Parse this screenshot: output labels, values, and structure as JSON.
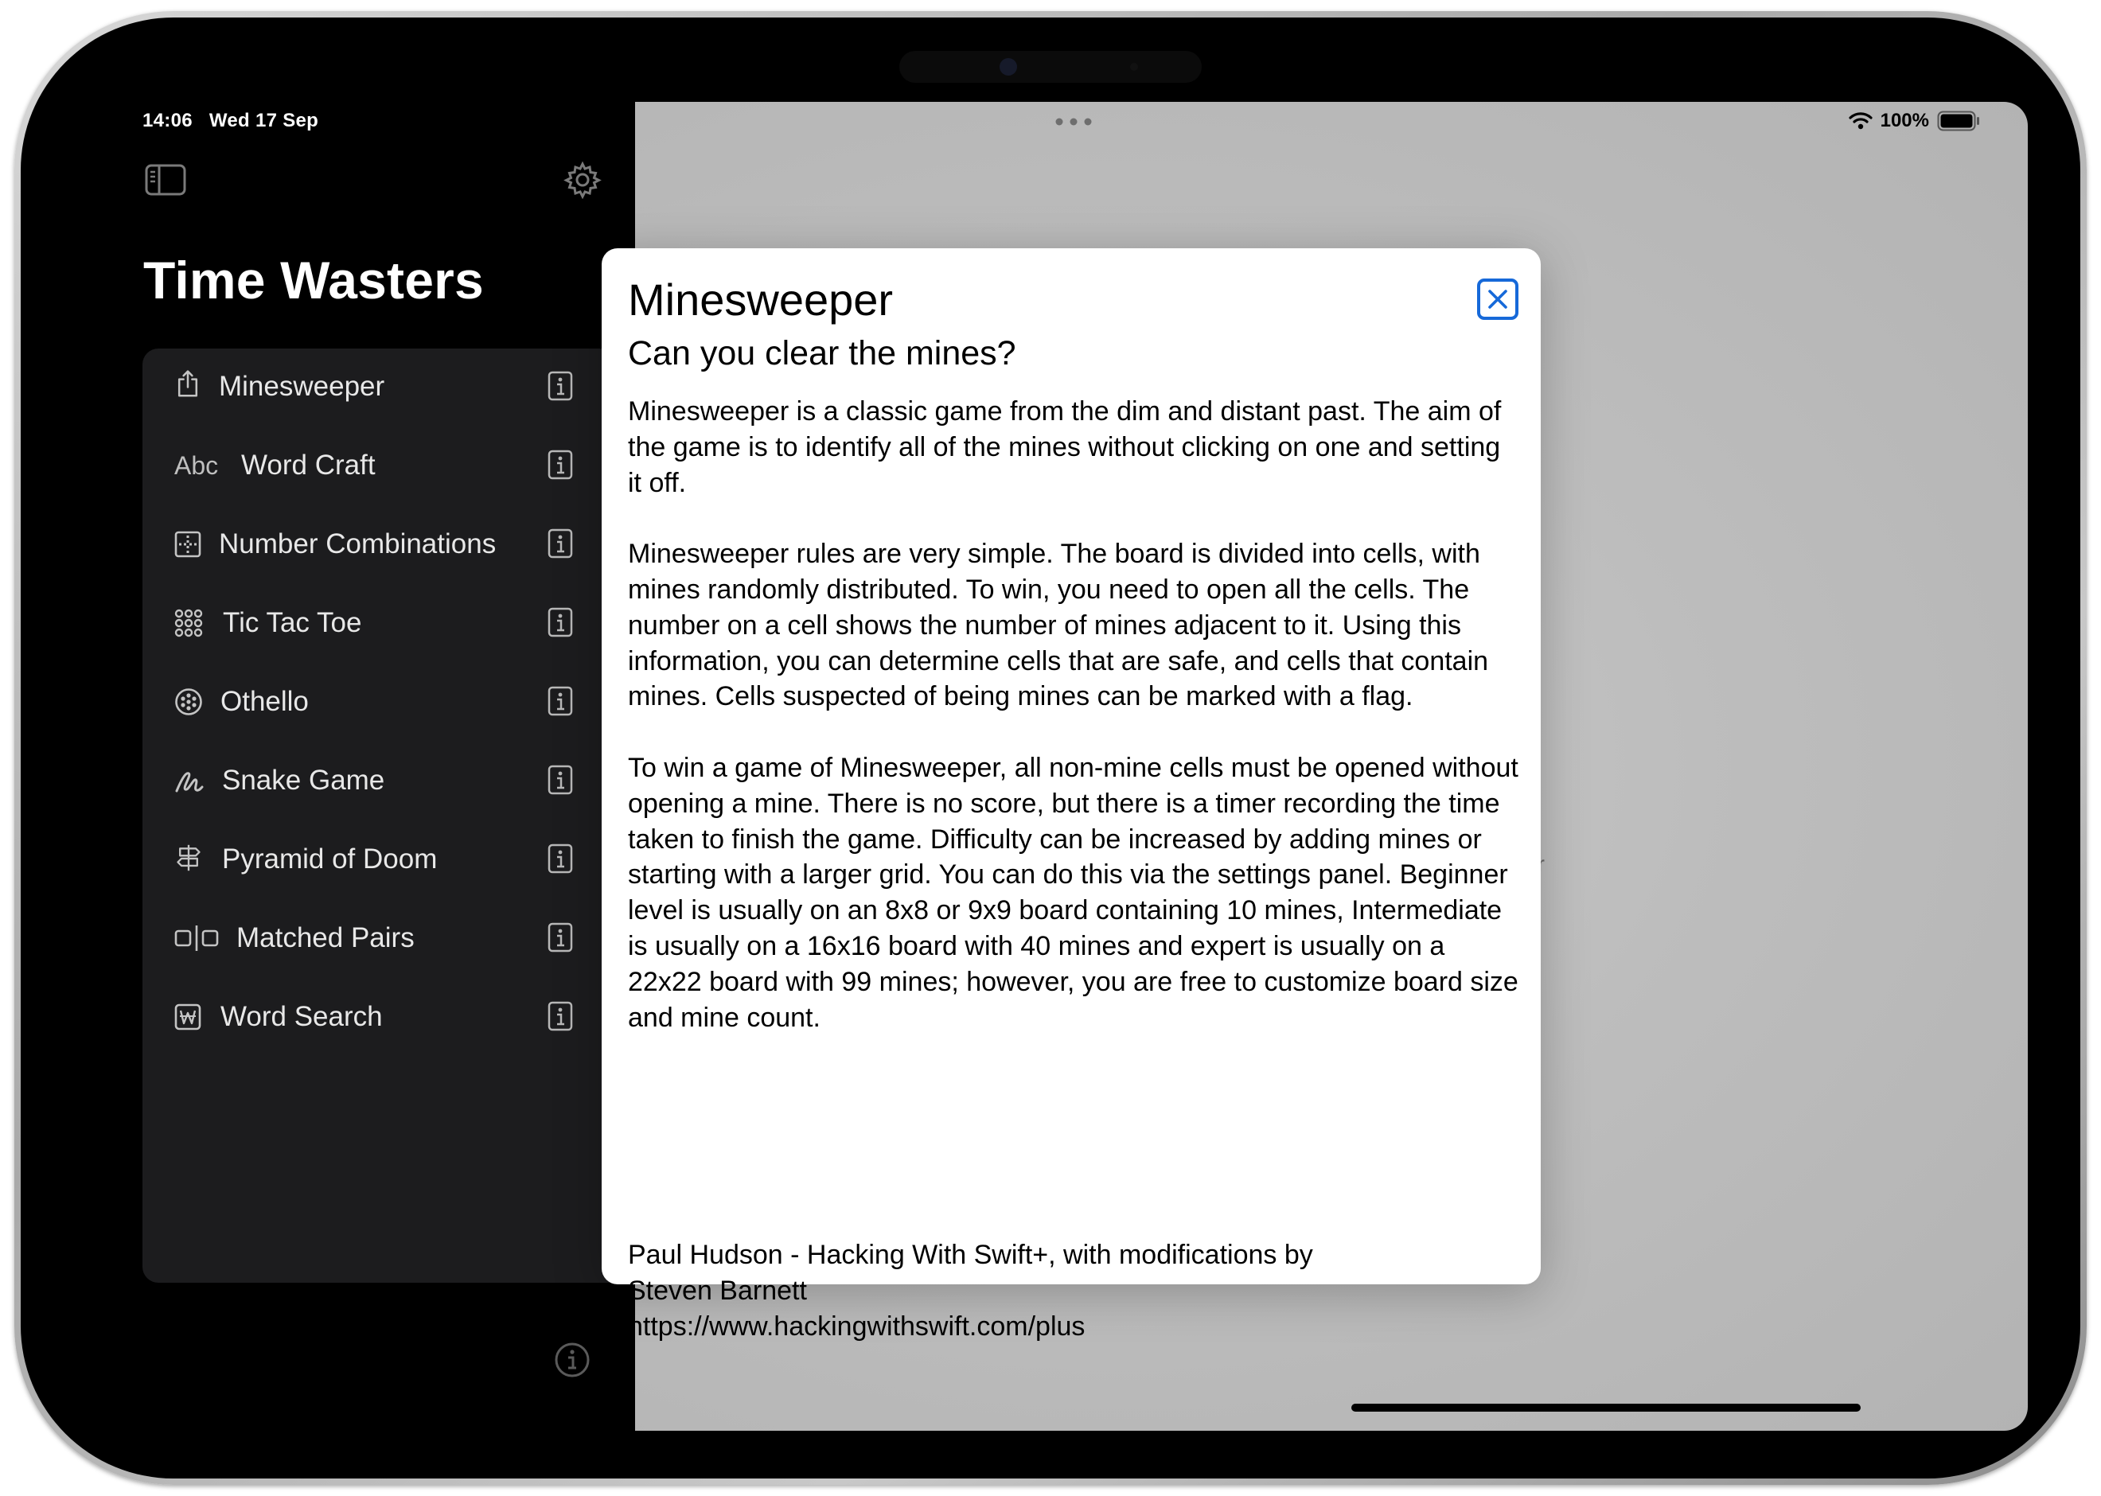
{
  "status_bar": {
    "time": "14:06",
    "date": "Wed 17 Sep",
    "battery_text": "100%",
    "battery_level": 1.0
  },
  "sidebar": {
    "title": "Time Wasters",
    "toggle_icon": "sidebar-left-icon",
    "settings_icon": "gear-icon",
    "items": [
      {
        "label": "Minesweeper",
        "icon": "share-icon"
      },
      {
        "label": "Word Craft",
        "icon": "abc-text-icon",
        "icon_text": "Abc"
      },
      {
        "label": "Number Combinations",
        "icon": "grid-icon"
      },
      {
        "label": "Tic Tac Toe",
        "icon": "dot-grid-icon"
      },
      {
        "label": "Othello",
        "icon": "circle-dots-icon"
      },
      {
        "label": "Snake Game",
        "icon": "scribble-icon"
      },
      {
        "label": "Pyramid of Doom",
        "icon": "signpost-icon"
      },
      {
        "label": "Matched Pairs",
        "icon": "pairs-icon"
      },
      {
        "label": "Word Search",
        "icon": "w-square-icon"
      }
    ],
    "info_icon": "info-square-icon",
    "bottom_info_icon": "info-circle-icon"
  },
  "detail": {
    "partial_text": "ar"
  },
  "modal": {
    "title": "Minesweeper",
    "subtitle": "Can you clear the mines?",
    "close_icon": "close-icon",
    "paragraphs": [
      "Minesweeper is a classic game from the dim and distant past. The aim of the game is to identify all of the mines without clicking on one and setting it off.",
      "Minesweeper rules are very simple. The board is divided into cells, with mines randomly distributed. To win, you need to open all the cells. The number on a cell shows the number of mines adjacent to it. Using this information, you can determine cells that are safe, and cells that contain mines. Cells suspected of being mines can be marked with a flag.",
      "To win a game of Minesweeper, all non-mine cells must be opened without opening a mine. There is no score, but there is a timer recording the time taken to finish the game. Difficulty can be increased by adding mines or starting with a larger grid. You can do this via the settings panel. Beginner level is usually on an 8x8 or 9x9 board containing 10 mines, Intermediate is usually on a 16x16 board with 40 mines and expert is usually on a 22x22 board with 99 mines; however, you are free to customize board size and mine count."
    ],
    "credit_line1": "Paul Hudson - Hacking With Swift+, with modifications by",
    "credit_line2": "Steven Barnett",
    "credit_url": "https://www.hackingwithswift.com/plus"
  },
  "colors": {
    "accent": "#1669d9",
    "sidebar_bg": "#000000",
    "list_bg": "#1c1c1e"
  }
}
